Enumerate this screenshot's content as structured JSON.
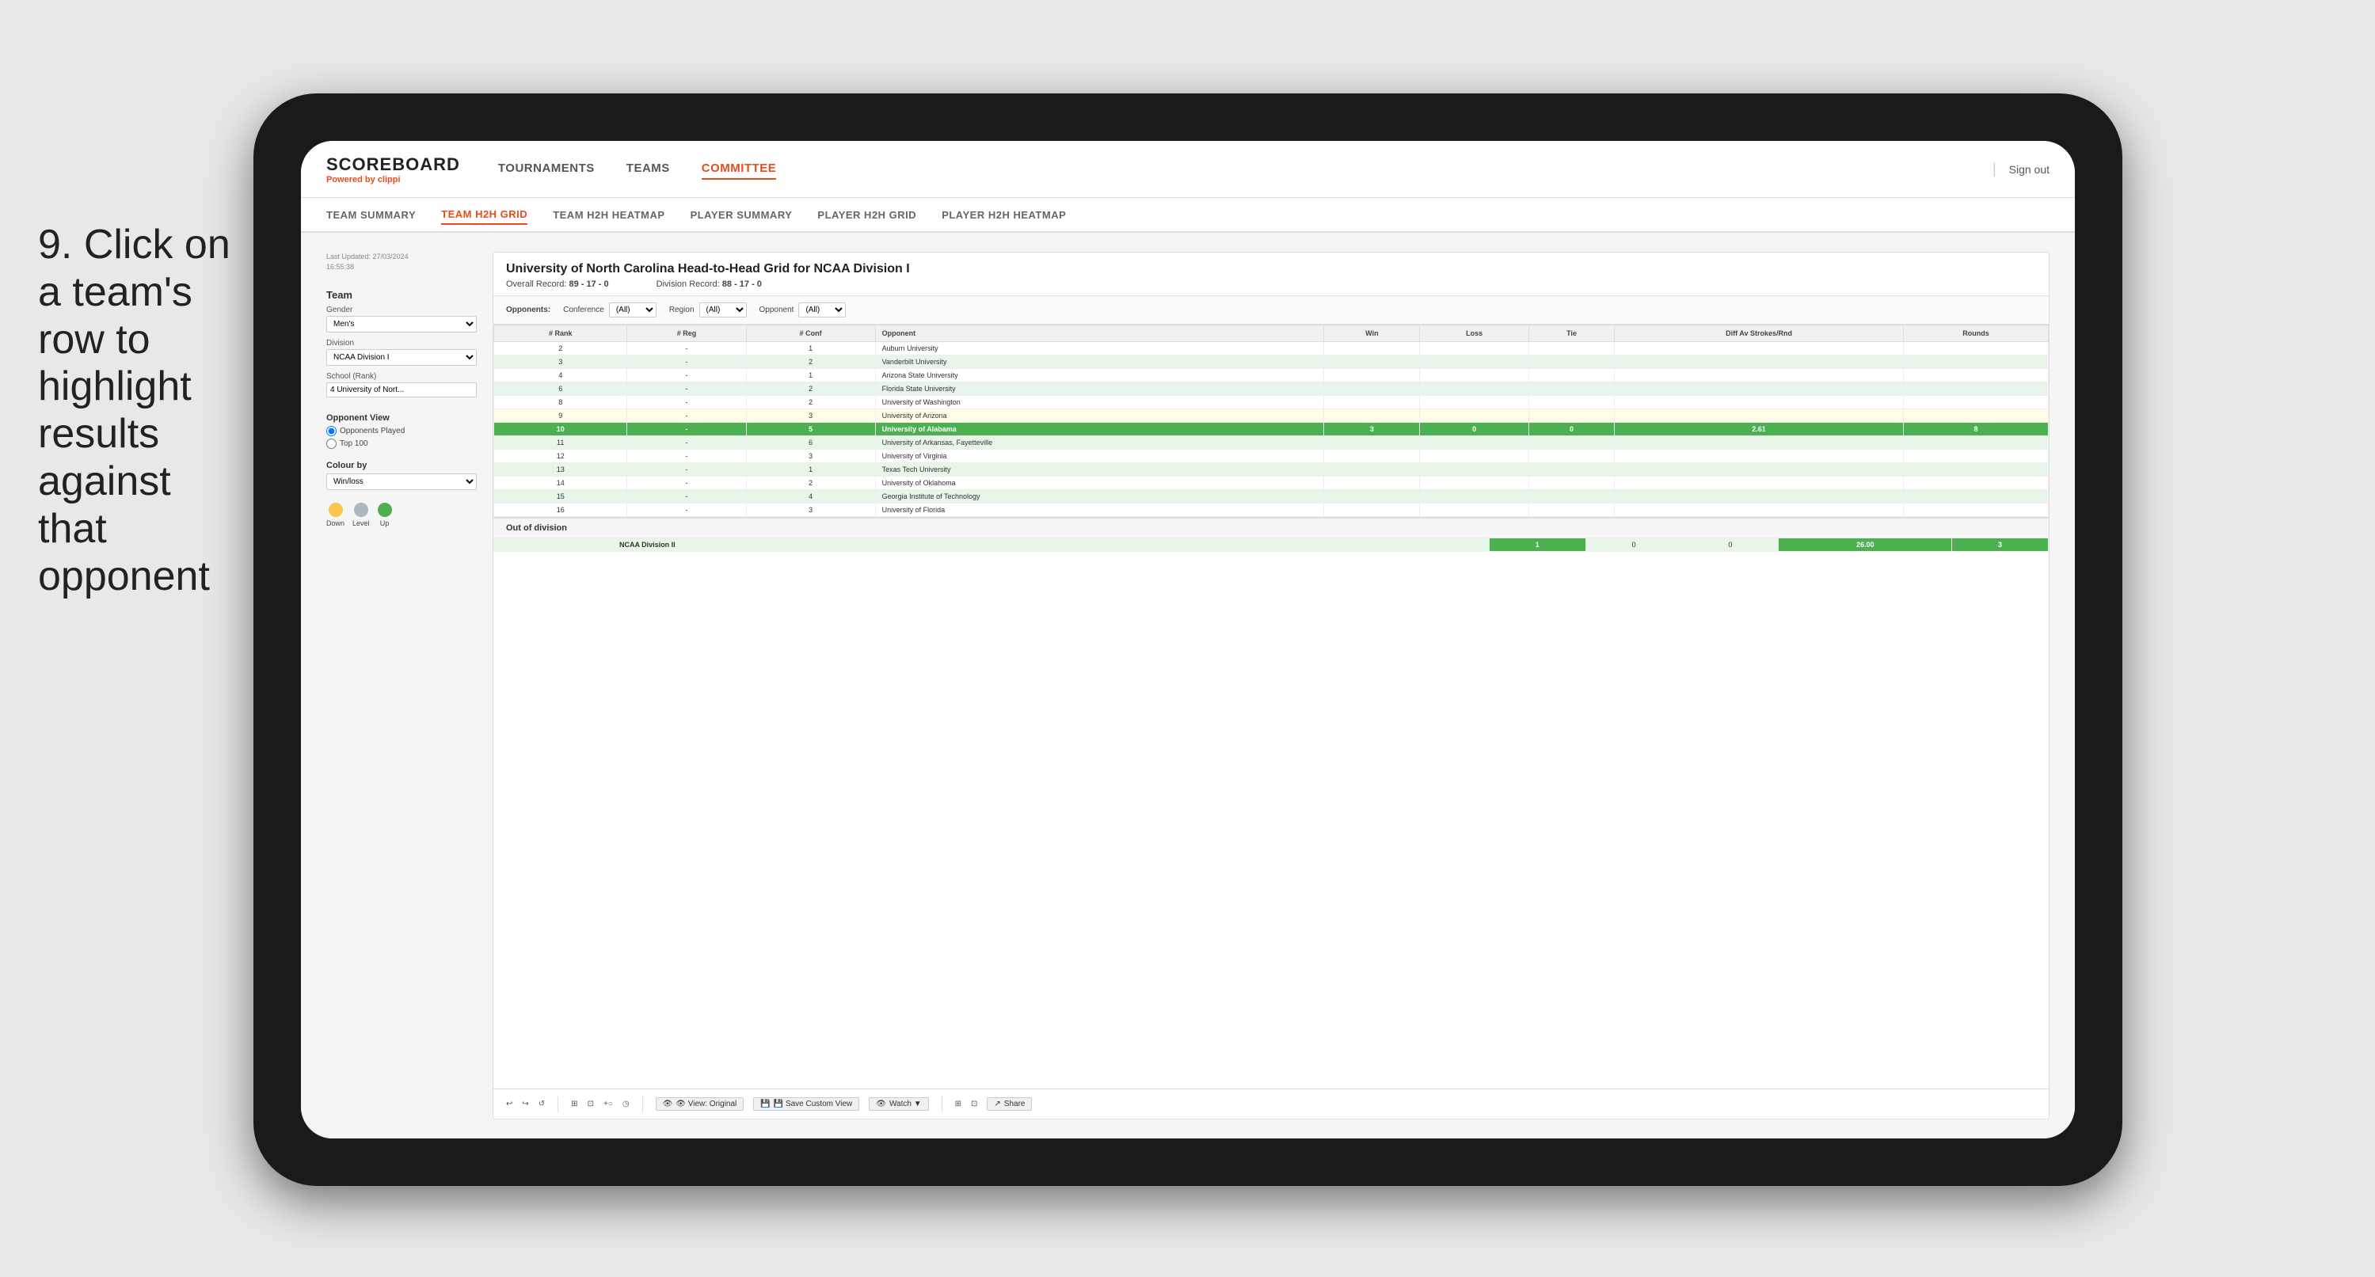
{
  "instruction": {
    "number": "9.",
    "text": "Click on a team's row to highlight results against that opponent"
  },
  "nav": {
    "logo": "SCOREBOARD",
    "logo_sub": "Powered by",
    "logo_brand": "clippi",
    "items": [
      "TOURNAMENTS",
      "TEAMS",
      "COMMITTEE"
    ],
    "sign_out": "Sign out"
  },
  "sub_nav": {
    "items": [
      "TEAM SUMMARY",
      "TEAM H2H GRID",
      "TEAM H2H HEATMAP",
      "PLAYER SUMMARY",
      "PLAYER H2H GRID",
      "PLAYER H2H HEATMAP"
    ],
    "active": "TEAM H2H GRID"
  },
  "sidebar": {
    "last_updated_label": "Last Updated: 27/03/2024",
    "last_updated_time": "16:55:38",
    "team_section": "Team",
    "gender_label": "Gender",
    "gender_value": "Men's",
    "division_label": "Division",
    "division_value": "NCAA Division I",
    "school_label": "School (Rank)",
    "school_value": "4 University of Nort...",
    "opponent_view_title": "Opponent View",
    "radio_opponents": "Opponents Played",
    "radio_top100": "Top 100",
    "colour_by_title": "Colour by",
    "colour_by_value": "Win/loss",
    "legend": {
      "down_label": "Down",
      "down_color": "#f9c74f",
      "level_label": "Level",
      "level_color": "#adb5bd",
      "up_label": "Up",
      "up_color": "#4caf50"
    }
  },
  "grid": {
    "title": "University of North Carolina Head-to-Head Grid for NCAA Division I",
    "overall_record_label": "Overall Record:",
    "overall_record": "89 - 17 - 0",
    "division_record_label": "Division Record:",
    "division_record": "88 - 17 - 0",
    "filters": {
      "opponents_label": "Opponents:",
      "conference_label": "Conference",
      "conference_value": "(All)",
      "region_label": "Region",
      "region_value": "(All)",
      "opponent_label": "Opponent",
      "opponent_value": "(All)"
    },
    "columns": [
      "# Rank",
      "# Reg",
      "# Conf",
      "Opponent",
      "Win",
      "Loss",
      "Tie",
      "Diff Av Strokes/Rnd",
      "Rounds"
    ],
    "rows": [
      {
        "rank": "2",
        "reg": "-",
        "conf": "1",
        "opponent": "Auburn University",
        "win": "",
        "loss": "",
        "tie": "",
        "diff": "",
        "rounds": "",
        "style": "normal"
      },
      {
        "rank": "3",
        "reg": "-",
        "conf": "2",
        "opponent": "Vanderbilt University",
        "win": "",
        "loss": "",
        "tie": "",
        "diff": "",
        "rounds": "",
        "style": "light-green"
      },
      {
        "rank": "4",
        "reg": "-",
        "conf": "1",
        "opponent": "Arizona State University",
        "win": "",
        "loss": "",
        "tie": "",
        "diff": "",
        "rounds": "",
        "style": "normal"
      },
      {
        "rank": "6",
        "reg": "-",
        "conf": "2",
        "opponent": "Florida State University",
        "win": "",
        "loss": "",
        "tie": "",
        "diff": "",
        "rounds": "",
        "style": "light-green"
      },
      {
        "rank": "8",
        "reg": "-",
        "conf": "2",
        "opponent": "University of Washington",
        "win": "",
        "loss": "",
        "tie": "",
        "diff": "",
        "rounds": "",
        "style": "normal"
      },
      {
        "rank": "9",
        "reg": "-",
        "conf": "3",
        "opponent": "University of Arizona",
        "win": "",
        "loss": "",
        "tie": "",
        "diff": "",
        "rounds": "",
        "style": "light-yellow"
      },
      {
        "rank": "10",
        "reg": "-",
        "conf": "5",
        "opponent": "University of Alabama",
        "win": "3",
        "loss": "0",
        "tie": "0",
        "diff": "2.61",
        "rounds": "8",
        "style": "highlighted"
      },
      {
        "rank": "11",
        "reg": "-",
        "conf": "6",
        "opponent": "University of Arkansas, Fayetteville",
        "win": "",
        "loss": "",
        "tie": "",
        "diff": "",
        "rounds": "",
        "style": "light-green"
      },
      {
        "rank": "12",
        "reg": "-",
        "conf": "3",
        "opponent": "University of Virginia",
        "win": "",
        "loss": "",
        "tie": "",
        "diff": "",
        "rounds": "",
        "style": "normal"
      },
      {
        "rank": "13",
        "reg": "-",
        "conf": "1",
        "opponent": "Texas Tech University",
        "win": "",
        "loss": "",
        "tie": "",
        "diff": "",
        "rounds": "",
        "style": "light-green"
      },
      {
        "rank": "14",
        "reg": "-",
        "conf": "2",
        "opponent": "University of Oklahoma",
        "win": "",
        "loss": "",
        "tie": "",
        "diff": "",
        "rounds": "",
        "style": "normal"
      },
      {
        "rank": "15",
        "reg": "-",
        "conf": "4",
        "opponent": "Georgia Institute of Technology",
        "win": "",
        "loss": "",
        "tie": "",
        "diff": "",
        "rounds": "",
        "style": "light-green"
      },
      {
        "rank": "16",
        "reg": "-",
        "conf": "3",
        "opponent": "University of Florida",
        "win": "",
        "loss": "",
        "tie": "",
        "diff": "",
        "rounds": "",
        "style": "normal"
      }
    ],
    "out_of_division": {
      "header": "Out of division",
      "row": {
        "label": "NCAA Division II",
        "win": "1",
        "loss": "0",
        "tie": "0",
        "diff": "26.00",
        "rounds": "3",
        "style": "out-division"
      }
    }
  },
  "toolbar": {
    "undo": "↩",
    "redo": "↪",
    "revert": "↺",
    "view_label": "👁 View: Original",
    "save_custom": "💾 Save Custom View",
    "watch_label": "👁 Watch ▼",
    "icon1": "⊞",
    "icon2": "⊡",
    "share_label": "↗ Share"
  }
}
